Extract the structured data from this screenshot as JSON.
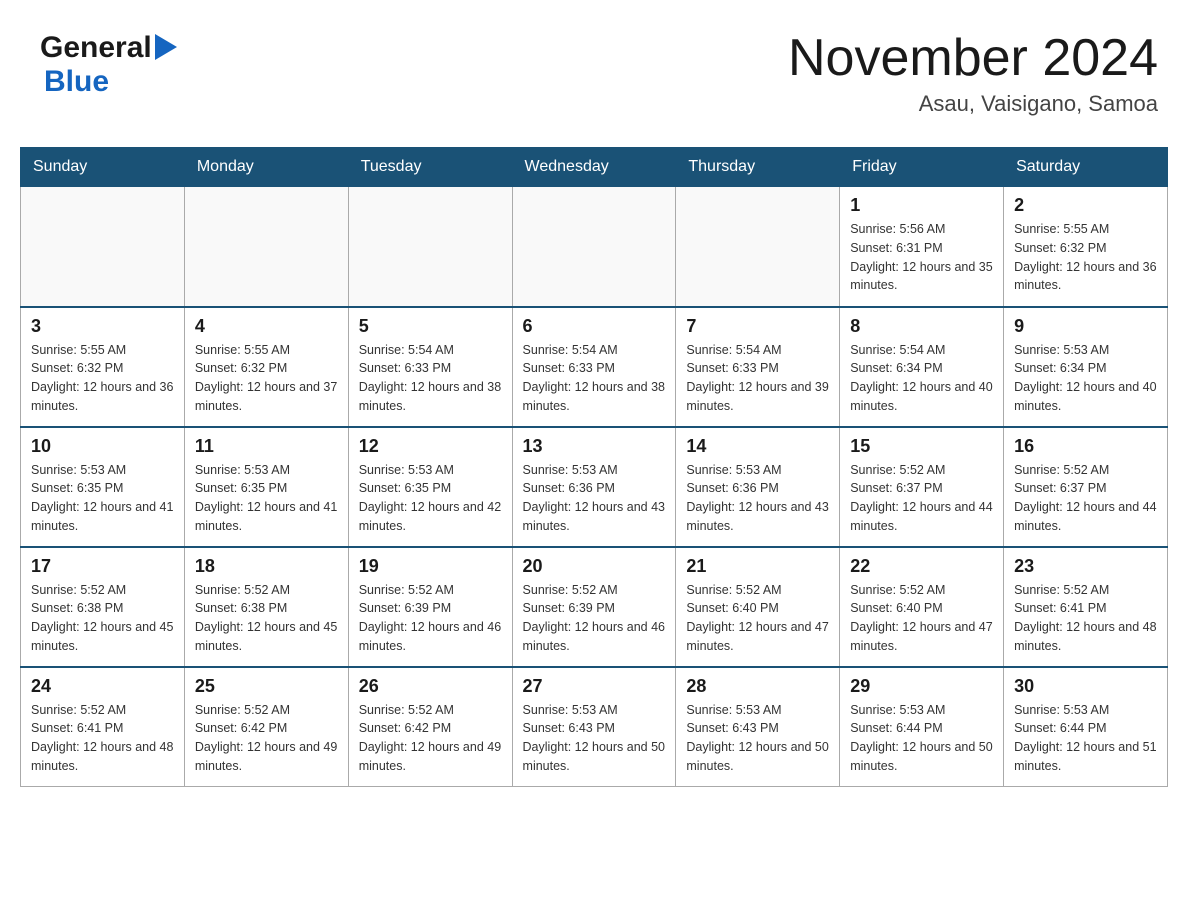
{
  "header": {
    "logo_general": "General",
    "logo_blue": "Blue",
    "title": "November 2024",
    "subtitle": "Asau, Vaisigano, Samoa"
  },
  "columns": [
    "Sunday",
    "Monday",
    "Tuesday",
    "Wednesday",
    "Thursday",
    "Friday",
    "Saturday"
  ],
  "weeks": [
    [
      {
        "day": "",
        "sunrise": "",
        "sunset": "",
        "daylight": ""
      },
      {
        "day": "",
        "sunrise": "",
        "sunset": "",
        "daylight": ""
      },
      {
        "day": "",
        "sunrise": "",
        "sunset": "",
        "daylight": ""
      },
      {
        "day": "",
        "sunrise": "",
        "sunset": "",
        "daylight": ""
      },
      {
        "day": "",
        "sunrise": "",
        "sunset": "",
        "daylight": ""
      },
      {
        "day": "1",
        "sunrise": "Sunrise: 5:56 AM",
        "sunset": "Sunset: 6:31 PM",
        "daylight": "Daylight: 12 hours and 35 minutes."
      },
      {
        "day": "2",
        "sunrise": "Sunrise: 5:55 AM",
        "sunset": "Sunset: 6:32 PM",
        "daylight": "Daylight: 12 hours and 36 minutes."
      }
    ],
    [
      {
        "day": "3",
        "sunrise": "Sunrise: 5:55 AM",
        "sunset": "Sunset: 6:32 PM",
        "daylight": "Daylight: 12 hours and 36 minutes."
      },
      {
        "day": "4",
        "sunrise": "Sunrise: 5:55 AM",
        "sunset": "Sunset: 6:32 PM",
        "daylight": "Daylight: 12 hours and 37 minutes."
      },
      {
        "day": "5",
        "sunrise": "Sunrise: 5:54 AM",
        "sunset": "Sunset: 6:33 PM",
        "daylight": "Daylight: 12 hours and 38 minutes."
      },
      {
        "day": "6",
        "sunrise": "Sunrise: 5:54 AM",
        "sunset": "Sunset: 6:33 PM",
        "daylight": "Daylight: 12 hours and 38 minutes."
      },
      {
        "day": "7",
        "sunrise": "Sunrise: 5:54 AM",
        "sunset": "Sunset: 6:33 PM",
        "daylight": "Daylight: 12 hours and 39 minutes."
      },
      {
        "day": "8",
        "sunrise": "Sunrise: 5:54 AM",
        "sunset": "Sunset: 6:34 PM",
        "daylight": "Daylight: 12 hours and 40 minutes."
      },
      {
        "day": "9",
        "sunrise": "Sunrise: 5:53 AM",
        "sunset": "Sunset: 6:34 PM",
        "daylight": "Daylight: 12 hours and 40 minutes."
      }
    ],
    [
      {
        "day": "10",
        "sunrise": "Sunrise: 5:53 AM",
        "sunset": "Sunset: 6:35 PM",
        "daylight": "Daylight: 12 hours and 41 minutes."
      },
      {
        "day": "11",
        "sunrise": "Sunrise: 5:53 AM",
        "sunset": "Sunset: 6:35 PM",
        "daylight": "Daylight: 12 hours and 41 minutes."
      },
      {
        "day": "12",
        "sunrise": "Sunrise: 5:53 AM",
        "sunset": "Sunset: 6:35 PM",
        "daylight": "Daylight: 12 hours and 42 minutes."
      },
      {
        "day": "13",
        "sunrise": "Sunrise: 5:53 AM",
        "sunset": "Sunset: 6:36 PM",
        "daylight": "Daylight: 12 hours and 43 minutes."
      },
      {
        "day": "14",
        "sunrise": "Sunrise: 5:53 AM",
        "sunset": "Sunset: 6:36 PM",
        "daylight": "Daylight: 12 hours and 43 minutes."
      },
      {
        "day": "15",
        "sunrise": "Sunrise: 5:52 AM",
        "sunset": "Sunset: 6:37 PM",
        "daylight": "Daylight: 12 hours and 44 minutes."
      },
      {
        "day": "16",
        "sunrise": "Sunrise: 5:52 AM",
        "sunset": "Sunset: 6:37 PM",
        "daylight": "Daylight: 12 hours and 44 minutes."
      }
    ],
    [
      {
        "day": "17",
        "sunrise": "Sunrise: 5:52 AM",
        "sunset": "Sunset: 6:38 PM",
        "daylight": "Daylight: 12 hours and 45 minutes."
      },
      {
        "day": "18",
        "sunrise": "Sunrise: 5:52 AM",
        "sunset": "Sunset: 6:38 PM",
        "daylight": "Daylight: 12 hours and 45 minutes."
      },
      {
        "day": "19",
        "sunrise": "Sunrise: 5:52 AM",
        "sunset": "Sunset: 6:39 PM",
        "daylight": "Daylight: 12 hours and 46 minutes."
      },
      {
        "day": "20",
        "sunrise": "Sunrise: 5:52 AM",
        "sunset": "Sunset: 6:39 PM",
        "daylight": "Daylight: 12 hours and 46 minutes."
      },
      {
        "day": "21",
        "sunrise": "Sunrise: 5:52 AM",
        "sunset": "Sunset: 6:40 PM",
        "daylight": "Daylight: 12 hours and 47 minutes."
      },
      {
        "day": "22",
        "sunrise": "Sunrise: 5:52 AM",
        "sunset": "Sunset: 6:40 PM",
        "daylight": "Daylight: 12 hours and 47 minutes."
      },
      {
        "day": "23",
        "sunrise": "Sunrise: 5:52 AM",
        "sunset": "Sunset: 6:41 PM",
        "daylight": "Daylight: 12 hours and 48 minutes."
      }
    ],
    [
      {
        "day": "24",
        "sunrise": "Sunrise: 5:52 AM",
        "sunset": "Sunset: 6:41 PM",
        "daylight": "Daylight: 12 hours and 48 minutes."
      },
      {
        "day": "25",
        "sunrise": "Sunrise: 5:52 AM",
        "sunset": "Sunset: 6:42 PM",
        "daylight": "Daylight: 12 hours and 49 minutes."
      },
      {
        "day": "26",
        "sunrise": "Sunrise: 5:52 AM",
        "sunset": "Sunset: 6:42 PM",
        "daylight": "Daylight: 12 hours and 49 minutes."
      },
      {
        "day": "27",
        "sunrise": "Sunrise: 5:53 AM",
        "sunset": "Sunset: 6:43 PM",
        "daylight": "Daylight: 12 hours and 50 minutes."
      },
      {
        "day": "28",
        "sunrise": "Sunrise: 5:53 AM",
        "sunset": "Sunset: 6:43 PM",
        "daylight": "Daylight: 12 hours and 50 minutes."
      },
      {
        "day": "29",
        "sunrise": "Sunrise: 5:53 AM",
        "sunset": "Sunset: 6:44 PM",
        "daylight": "Daylight: 12 hours and 50 minutes."
      },
      {
        "day": "30",
        "sunrise": "Sunrise: 5:53 AM",
        "sunset": "Sunset: 6:44 PM",
        "daylight": "Daylight: 12 hours and 51 minutes."
      }
    ]
  ]
}
